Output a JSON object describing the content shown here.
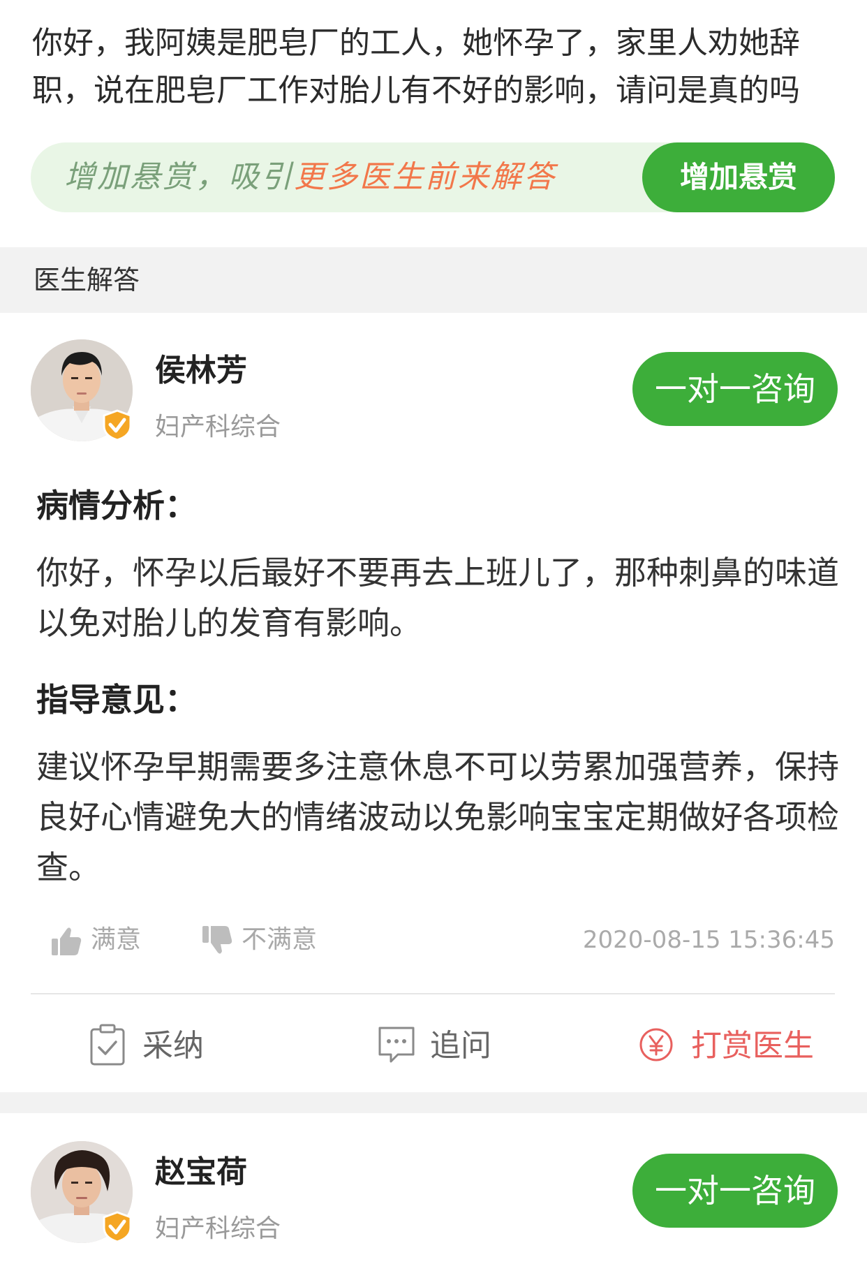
{
  "question": {
    "text": "你好，我阿姨是肥皂厂的工人，她怀孕了，家里人劝她辞职，说在肥皂厂工作对胎儿有不好的影响，请问是真的吗"
  },
  "reward": {
    "prompt_prefix": "增加悬赏，吸引",
    "prompt_highlight": "更多医生前来解答",
    "button_label": "增加悬赏"
  },
  "section": {
    "title": "医生解答"
  },
  "answers": [
    {
      "doctor_name": "侯林芳",
      "department": "妇产科综合",
      "consult_label": "一对一咨询",
      "analysis_heading": "病情分析：",
      "analysis_text": "你好，怀孕以后最好不要再去上班儿了，那种刺鼻的味道以免对胎儿的发育有影响。",
      "advice_heading": "指导意见：",
      "advice_text": "建议怀孕早期需要多注意休息不可以劳累加强营养，保持良好心情避免大的情绪波动以免影响宝宝定期做好各项检查。",
      "satisfied_label": "满意",
      "unsatisfied_label": "不满意",
      "timestamp": "2020-08-15 15:36:45",
      "adopt_label": "采纳",
      "follow_up_label": "追问",
      "tip_label": "打赏医生"
    },
    {
      "doctor_name": "赵宝荷",
      "department": "妇产科综合",
      "consult_label": "一对一咨询"
    }
  ],
  "colors": {
    "primary_green": "#3dae3a",
    "reward_bg": "#e9f6e6",
    "accent_orange": "#f2774a",
    "tip_red": "#e8605e",
    "badge_orange": "#f5a623"
  },
  "icons": {
    "verify": "verified-badge-icon",
    "satisfied": "thumbs-up-icon",
    "unsatisfied": "thumbs-down-icon",
    "adopt": "clipboard-check-icon",
    "follow_up": "chat-bubble-icon",
    "tip": "yen-coin-icon"
  }
}
